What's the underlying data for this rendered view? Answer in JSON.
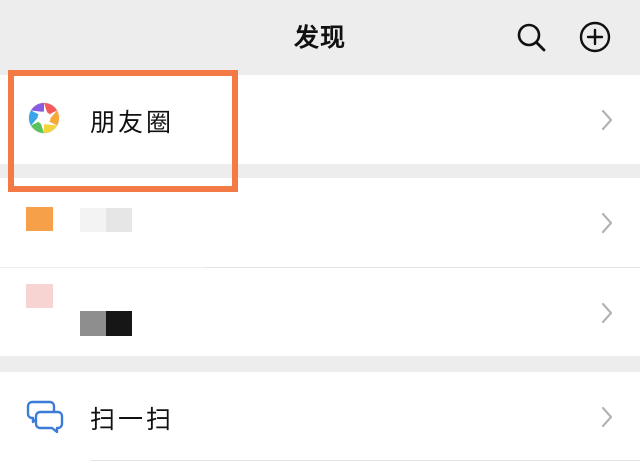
{
  "header": {
    "title": "发现",
    "search_icon": "search-icon",
    "add_icon": "plus-circle-icon"
  },
  "rows": {
    "moments": {
      "label": "朋友圈",
      "icon": "moments-aperture-icon"
    },
    "scan": {
      "label": "扫一扫",
      "icon": "scan-icon"
    }
  },
  "colors": {
    "background": "#ededed",
    "row": "#ffffff",
    "highlight_border": "#f47a45",
    "orange_square": "#f7a04a",
    "pink_square": "#f7d4d2",
    "scan_icon": "#3d7bd8"
  }
}
